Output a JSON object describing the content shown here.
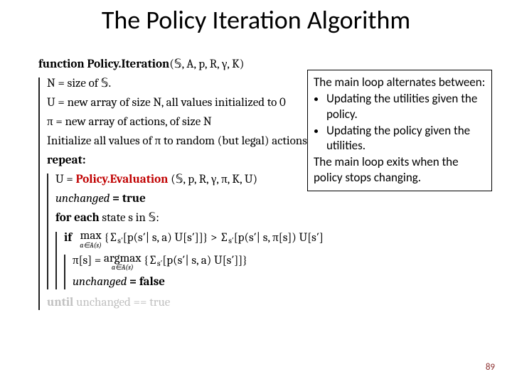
{
  "title": "The Policy Iteration Algorithm",
  "page_number": "89",
  "box": {
    "intro": "The main loop alternates between:",
    "bullets": [
      "Updating the utilities given the policy.",
      "Updating the policy given the utilities."
    ],
    "outro": "The main loop exits when the policy stops changing."
  },
  "algo": {
    "fn_kw": "function",
    "fn_name": "Policy.Iteration",
    "fn_args": "(𝕊, A, p, R, γ, K)",
    "line_N": "N = size of 𝕊.",
    "line_U": "U = new array of size N, all values initialized to 0",
    "line_pi": "π = new array of actions, of size N",
    "line_init": "Initialize all values of π to random (but legal) actions",
    "repeat_kw": "repeat:",
    "eval_lhs": "U = ",
    "eval_call": "Policy.Evaluation",
    "eval_args": "(𝕊, p, R, γ, π, K, U)",
    "unchanged_true_lhs": "unchanged",
    "unchanged_true_rhs": " = true",
    "foreach_kw": "for each",
    "foreach_rest": " state  s  in 𝕊:",
    "if_kw": "if",
    "if_expr_left": "{∑",
    "if_sub_left": "s′",
    "if_bracket_left": "[p(s′| s, a) U[s′]]} > ∑",
    "if_sub_right": "s′",
    "if_bracket_right": "[p(s′| s, π[s]) U[s′]",
    "max_label": "max",
    "max_under": "a∈A(s)",
    "pi_assign": "π[s] = ",
    "argmax_label": "argmax",
    "argmax_body": "{∑",
    "argmax_sub": "s′",
    "argmax_rest": "[p(s′| s, a) U[s′]]}",
    "unchanged_false_lhs": "unchanged",
    "unchanged_false_rhs": " = false",
    "until_kw": "until",
    "until_rest": "  unchanged == true"
  }
}
